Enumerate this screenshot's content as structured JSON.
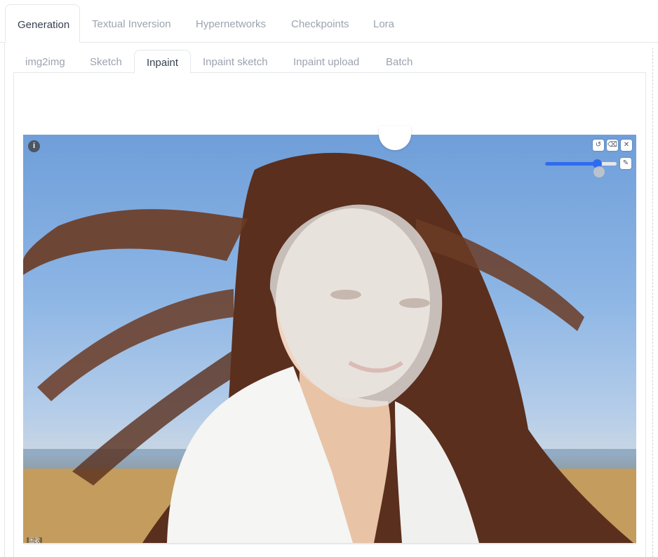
{
  "top_tabs": {
    "items": [
      {
        "label": "Generation",
        "active": true
      },
      {
        "label": "Textual Inversion"
      },
      {
        "label": "Hypernetworks"
      },
      {
        "label": "Checkpoints"
      },
      {
        "label": "Lora"
      }
    ]
  },
  "sub_tabs": {
    "items": [
      {
        "label": "img2img"
      },
      {
        "label": "Sketch"
      },
      {
        "label": "Inpaint",
        "active": true
      },
      {
        "label": "Inpaint sketch"
      },
      {
        "label": "Inpaint upload"
      },
      {
        "label": "Batch"
      }
    ]
  },
  "canvas": {
    "info_icon": "info-icon",
    "toolbar_icons": [
      "undo-icon",
      "clear-icon",
      "close-icon",
      "brush-icon"
    ],
    "brush_size_fraction": 0.73,
    "brush_color": "#2f6bf0",
    "mask_color": "#e6e6e6",
    "image_label": "图歌"
  },
  "colors": {
    "tab_active": "#374151",
    "tab_inactive": "#9ca3af",
    "border": "#e5e7eb"
  }
}
